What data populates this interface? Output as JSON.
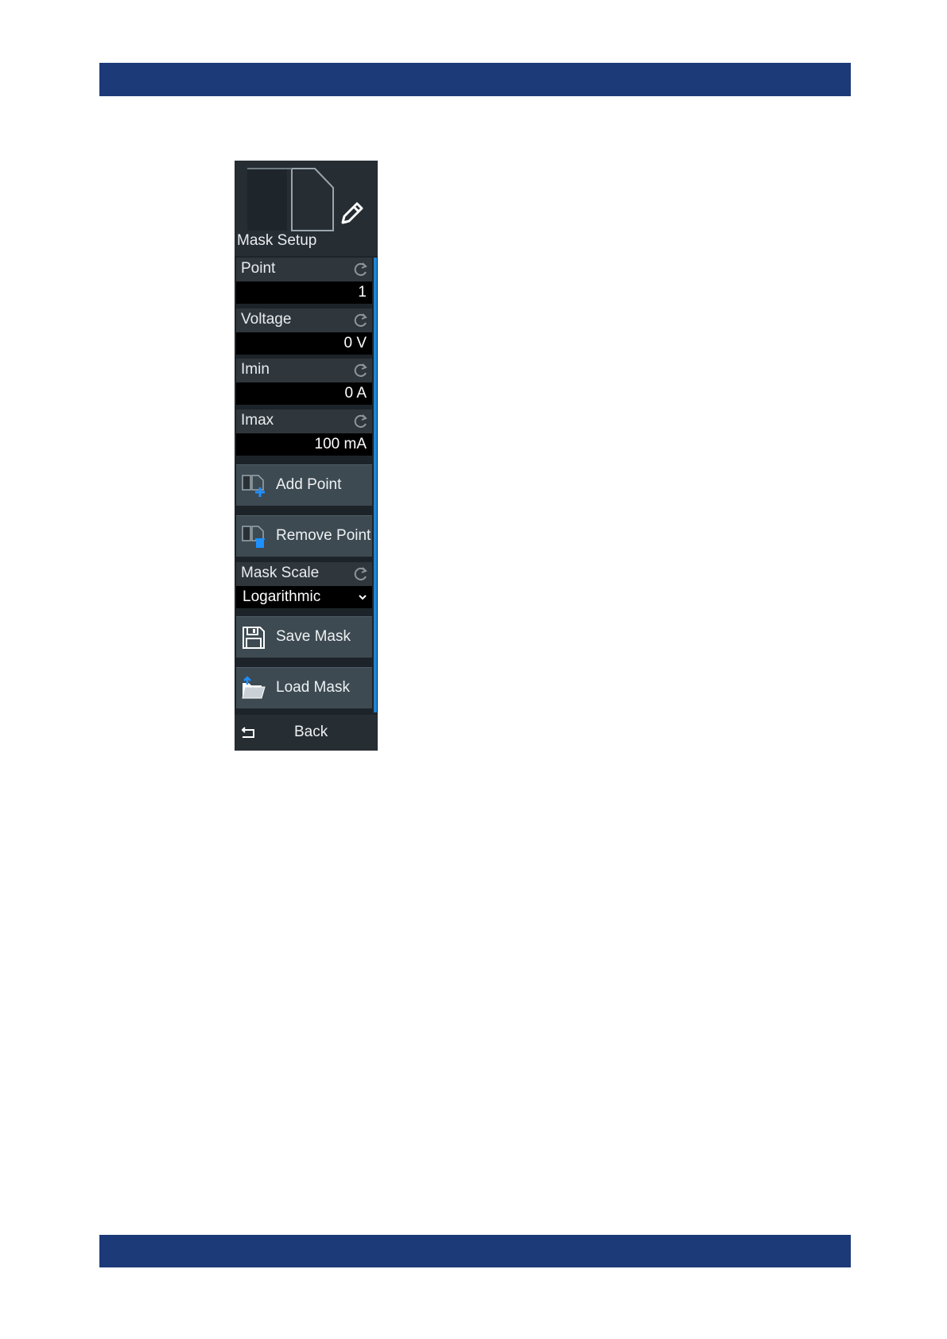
{
  "panel": {
    "title": "Mask Setup",
    "header_icon": "mask-page-icon",
    "edit_icon": "pencil-icon",
    "params": [
      {
        "label": "Point",
        "value": "1",
        "reset_icon": "reset-icon"
      },
      {
        "label": "Voltage",
        "value": "0 V",
        "reset_icon": "reset-icon"
      },
      {
        "label": "Imin",
        "value": "0 A",
        "reset_icon": "reset-icon"
      },
      {
        "label": "Imax",
        "value": "100 mA",
        "reset_icon": "reset-icon"
      }
    ],
    "add_point": {
      "label": "Add Point",
      "icon": "add-point-icon"
    },
    "remove_point": {
      "label": "Remove Point",
      "icon": "remove-point-icon"
    },
    "mask_scale": {
      "label": "Mask Scale",
      "value": "Logarithmic",
      "reset_icon": "reset-icon",
      "dropdown_icon": "chevron-down-icon"
    },
    "save_mask": {
      "label": "Save Mask",
      "icon": "floppy-disk-icon"
    },
    "load_mask": {
      "label": "Load Mask",
      "icon": "folder-open-icon"
    },
    "back": {
      "label": "Back",
      "icon": "back-arrow-icon"
    }
  },
  "colors": {
    "header_band": "#1c3a78",
    "panel_bg": "#1d2429",
    "button_bg": "#3d4a52",
    "scrollbar": "#1f86d6",
    "accent_icon": "#1e90ff"
  }
}
